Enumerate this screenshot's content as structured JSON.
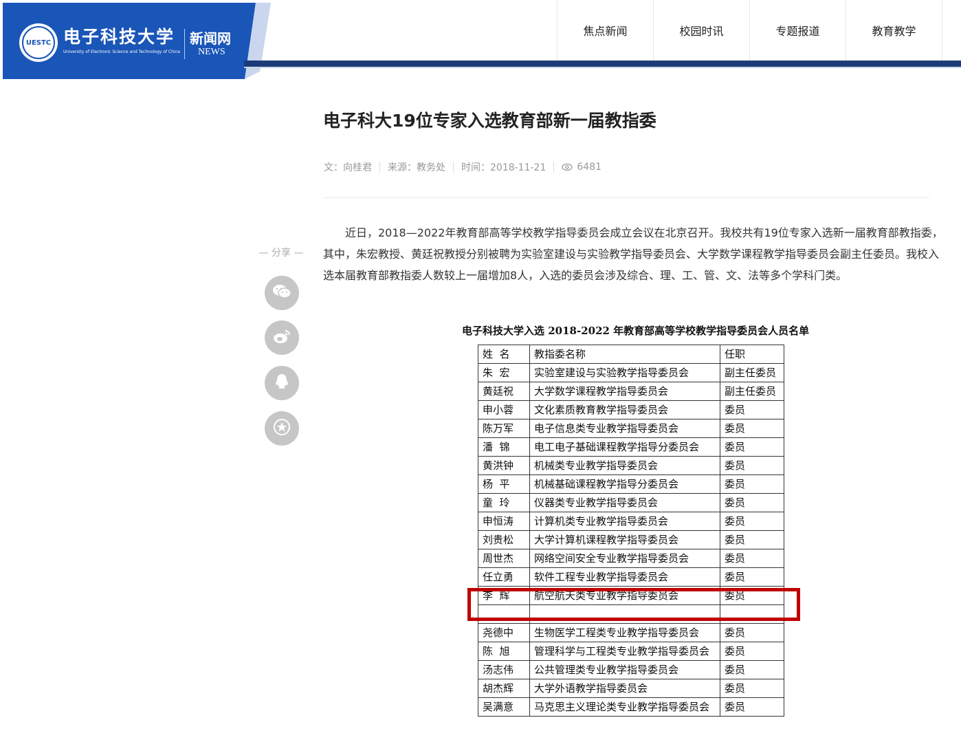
{
  "header": {
    "university_name_cn": "电子科技大学",
    "university_name_en": "University of Electronic Science and Technology of China",
    "emblem_text": "UESTC",
    "site_name_cn": "新闻网",
    "site_name_en": "NEWS",
    "brand_color": "#1a55b8",
    "nav_line_color": "#1b3c78"
  },
  "nav": {
    "items": [
      {
        "label": "焦点新闻"
      },
      {
        "label": "校园时讯"
      },
      {
        "label": "专题报道"
      },
      {
        "label": "教育教学"
      }
    ]
  },
  "article": {
    "title": "电子科大19位专家入选教育部新一届教指委",
    "author": "文：向桂君",
    "source": "来源：教务处",
    "time": "时间：2018-11-21",
    "views": "6481",
    "body": "近日，2018—2022年教育部高等学校教学指导委员会成立会议在北京召开。我校共有19位专家入选新一届教育部教指委，其中，朱宏教授、黄廷祝教授分别被聘为实验室建设与实验教学指导委员会、大学数学课程教学指导委员会副主任委员。我校入选本届教育部教指委人数较上一届增加8人，入选的委员会涉及综合、理、工、管、文、法等多个学科门类。"
  },
  "share": {
    "label": "— 分享 —",
    "buttons": [
      "wechat-icon",
      "weibo-icon",
      "qq-icon",
      "favorite-icon"
    ]
  },
  "roster": {
    "title": "电子科技大学入选 2018-2022 年教育部高等学校教学指导委员会人员名单",
    "headers": [
      "姓  名",
      "教指委名称",
      "任职"
    ],
    "rows": [
      [
        "朱  宏",
        "实验室建设与实验教学指导委员会",
        "副主任委员"
      ],
      [
        "黄廷祝",
        "大学数学课程教学指导委员会",
        "副主任委员"
      ],
      [
        "申小蓉",
        "文化素质教育教学指导委员会",
        "委员"
      ],
      [
        "陈万军",
        "电子信息类专业教学指导委员会",
        "委员"
      ],
      [
        "潘  锦",
        "电工电子基础课程教学指导分委员会",
        "委员"
      ],
      [
        "黄洪钟",
        "机械类专业教学指导委员会",
        "委员"
      ],
      [
        "杨  平",
        "机械基础课程教学指导分委员会",
        "委员"
      ],
      [
        "童  玲",
        "仪器类专业教学指导委员会",
        "委员"
      ],
      [
        "申恒涛",
        "计算机类专业教学指导委员会",
        "委员"
      ],
      [
        "刘贵松",
        "大学计算机课程教学指导委员会",
        "委员"
      ],
      [
        "周世杰",
        "网络空间安全专业教学指导委员会",
        "委员"
      ],
      [
        "任立勇",
        "软件工程专业教学指导委员会",
        "委员"
      ],
      [
        "李  辉",
        "航空航天类专业教学指导委员会",
        "委员"
      ],
      [
        "",
        "",
        ""
      ],
      [
        "尧德中",
        "生物医学工程类专业教学指导委员会",
        "委员"
      ],
      [
        "陈  旭",
        "管理科学与工程类专业教学指导委员会",
        "委员"
      ],
      [
        "汤志伟",
        "公共管理类专业教学指导委员会",
        "委员"
      ],
      [
        "胡杰辉",
        "大学外语教学指导委员会",
        "委员"
      ],
      [
        "吴满意",
        "马克思主义理论类专业教学指导委员会",
        "委员"
      ]
    ],
    "highlight_color": "#c00000"
  }
}
